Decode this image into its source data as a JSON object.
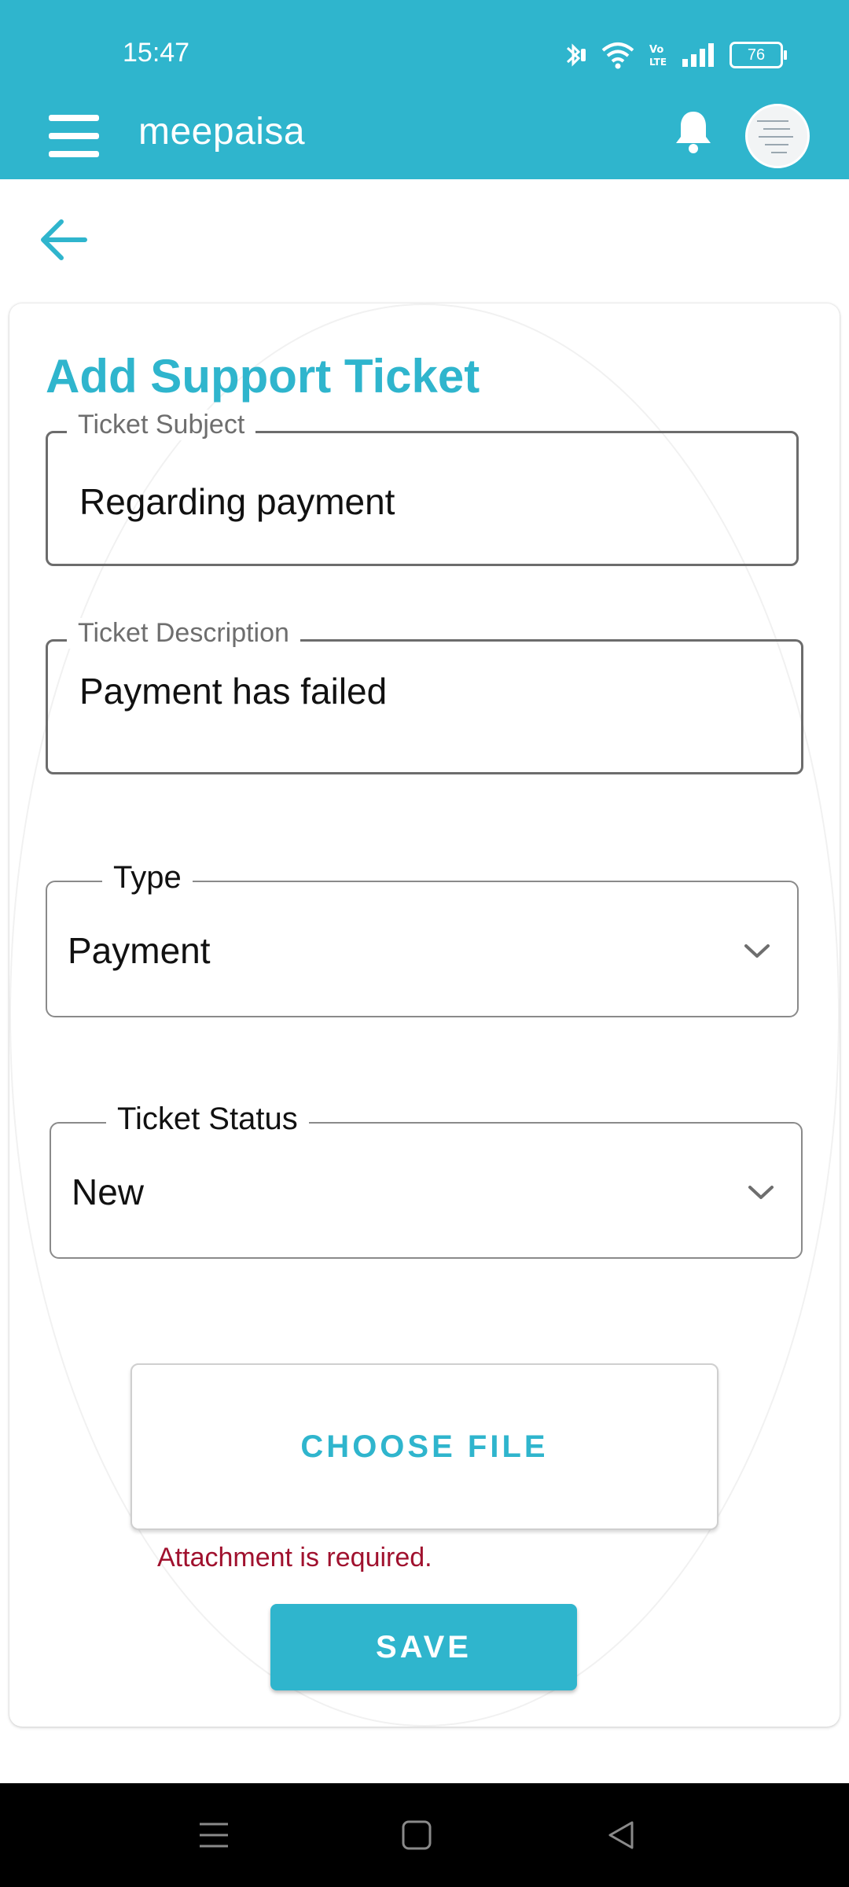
{
  "status_bar": {
    "time": "15:47",
    "battery_level": "76",
    "icons": [
      "bluetooth-icon",
      "wifi-icon",
      "volte-icon",
      "signal-icon",
      "battery-icon"
    ]
  },
  "app_bar": {
    "brand": "meepaisa",
    "icons": [
      "menu-icon",
      "bell-icon",
      "avatar"
    ]
  },
  "form": {
    "title": "Add Support Ticket",
    "subject": {
      "label": "Ticket Subject",
      "value": "Regarding payment"
    },
    "description": {
      "label": "Ticket Description",
      "value": "Payment has failed"
    },
    "type": {
      "label": "Type",
      "selected": "Payment"
    },
    "status": {
      "label": "Ticket Status",
      "selected": "New"
    },
    "choose_file_label": "CHOOSE FILE",
    "attachment_error": "Attachment is required.",
    "save_label": "SAVE"
  },
  "colors": {
    "accent": "#2fb5cd",
    "error": "#a0112e"
  }
}
